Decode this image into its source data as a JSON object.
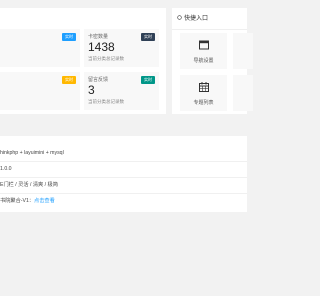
{
  "stats": {
    "cards": [
      {
        "title": "",
        "value": "",
        "sub": "",
        "badge": "实时",
        "badge_color": "#1e9fff"
      },
      {
        "title": "卡密数量",
        "value": "1438",
        "sub": "当前分类总记录数",
        "badge": "实时",
        "badge_color": "#2f4056"
      },
      {
        "title": "",
        "value": "",
        "sub": "",
        "badge": "实时",
        "badge_color": "#ffb800"
      },
      {
        "title": "留言反馈",
        "value": "3",
        "sub": "当前分类总记录数",
        "badge": "实时",
        "badge_color": "#009688"
      }
    ]
  },
  "quick": {
    "title": "快捷入口",
    "items": [
      {
        "label": "导航设置",
        "icon": "window-icon"
      },
      {
        "label": "专题列表",
        "icon": "calendar-icon"
      }
    ]
  },
  "info": {
    "rows": [
      {
        "text": "hinkphp + layuimini + mysql"
      },
      {
        "text": "1.0.0"
      },
      {
        "text": "E门栏 / 灵活 / 清爽 / 极简"
      },
      {
        "prefix": "书院聚合-V1：",
        "link": "点击查看"
      }
    ]
  }
}
